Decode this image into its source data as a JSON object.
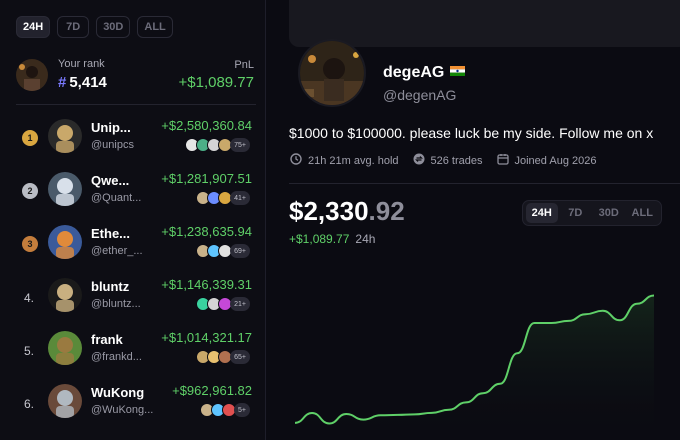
{
  "leaderboard": {
    "tabs": [
      {
        "label": "24H",
        "active": true
      },
      {
        "label": "7D",
        "active": false
      },
      {
        "label": "30D",
        "active": false
      },
      {
        "label": "ALL",
        "active": false
      }
    ],
    "your_rank": {
      "label": "Your rank",
      "hash": "#",
      "value": "5,414",
      "pnl_label": "PnL",
      "pnl_value": "+$1,089.77"
    },
    "rows": [
      {
        "rank": "1",
        "medal": "gold",
        "name": "Unip...",
        "handle": "@unipcs",
        "value": "+$2,580,360.84",
        "count": "75+",
        "colors": [
          "#e6e6e6",
          "#4caf87",
          "#d4d4d4",
          "#c9a86a"
        ]
      },
      {
        "rank": "2",
        "medal": "silver",
        "name": "Qwe...",
        "handle": "@Quant...",
        "value": "+$1,281,907.51",
        "count": "41+",
        "colors": [
          "#c9b28a",
          "#6b8cff",
          "#d9a640"
        ]
      },
      {
        "rank": "3",
        "medal": "bronze",
        "name": "Ethe...",
        "handle": "@ether_...",
        "value": "+$1,238,635.94",
        "count": "69+",
        "colors": [
          "#c9b28a",
          "#5ec4ff",
          "#e0e0e0"
        ]
      },
      {
        "rank": "4.",
        "medal": "",
        "name": "bluntz",
        "handle": "@bluntz...",
        "value": "+$1,146,339.31",
        "count": "21+",
        "colors": [
          "#3ad29f",
          "#d4d4d4",
          "#c548d8"
        ]
      },
      {
        "rank": "5.",
        "medal": "",
        "name": "frank",
        "handle": "@frankd...",
        "value": "+$1,014,321.17",
        "count": "65+",
        "colors": [
          "#c9a86a",
          "#e8c070",
          "#b07050"
        ]
      },
      {
        "rank": "6.",
        "medal": "",
        "name": "WuKong",
        "handle": "@WuKong...",
        "value": "+$962,961.82",
        "count": "5+",
        "colors": [
          "#c9b28a",
          "#5ec4ff",
          "#e05050"
        ]
      }
    ]
  },
  "profile": {
    "name": "degeAG",
    "handle": "@degenAG",
    "bio": "$1000 to $100000. please luck be my side. Follow me on x",
    "stats": {
      "hold": "21h 21m avg. hold",
      "trades": "526 trades",
      "joined": "Joined Aug 2026"
    },
    "balance_main": "$2,330",
    "balance_dec": ".92",
    "change_value": "+$1,089.77",
    "change_period": "24h",
    "chart_tabs": [
      {
        "label": "24H",
        "active": true
      },
      {
        "label": "7D",
        "active": false
      },
      {
        "label": "30D",
        "active": false
      },
      {
        "label": "ALL",
        "active": false
      }
    ],
    "accent": "#5fd068"
  },
  "chart_data": {
    "type": "area",
    "title": "",
    "xlabel": "",
    "ylabel": "",
    "color": "#5fd068",
    "values": [
      1241,
      1325,
      1236,
      1317,
      1269,
      1306,
      1309,
      1313,
      1326,
      1353,
      1416,
      1495,
      1575,
      1836,
      2095,
      2095,
      2113,
      2170,
      2199,
      2118,
      2259,
      2330
    ]
  }
}
